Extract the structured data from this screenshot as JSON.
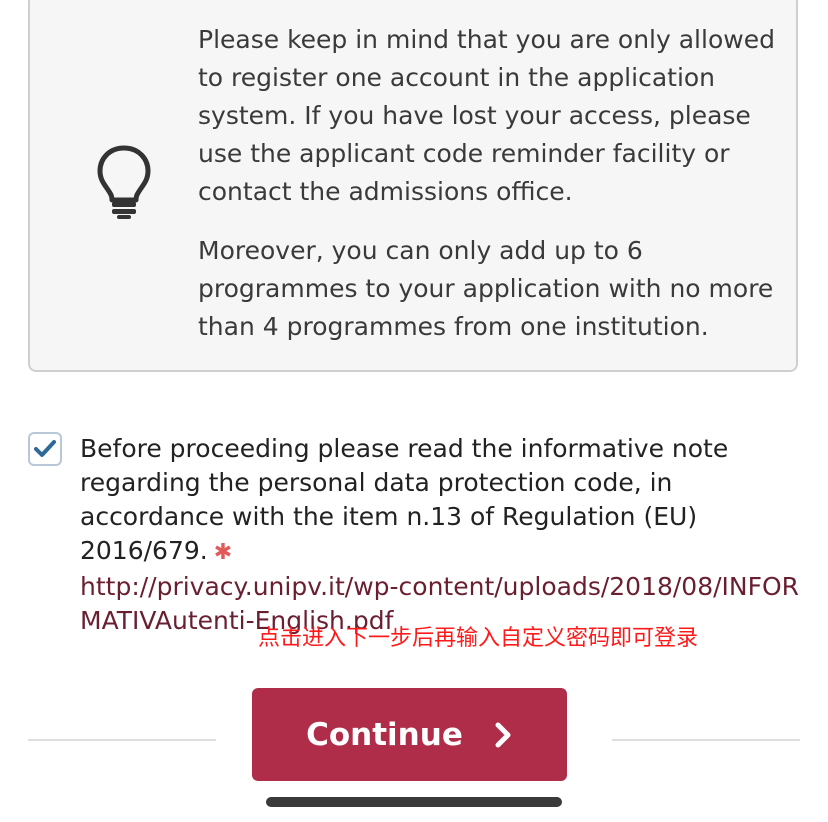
{
  "notice": {
    "icon": "lightbulb-icon",
    "paragraph_1": "Please keep in mind that you are only allowed to register one account in the application system. If you have lost your access, please use the applicant code reminder facility or contact the admissions office.",
    "paragraph_2": "Moreover, you can only add up to 6 programmes to your application with no more than 4 programmes from one institution."
  },
  "consent": {
    "checked": true,
    "text": "Before proceeding please read the informative note regarding the personal data protection code, in accordance with the item n.13 of Regulation (EU) 2016/679.",
    "required_marker": "✱",
    "link": "http://privacy.unipv.it/wp-content/uploads/2018/08/INFORMATIVAutenti-English.pdf"
  },
  "annotation": "点击进入下一步后再输入自定义密码即可登录",
  "actions": {
    "continue_label": "Continue",
    "continue_icon": "chevron-right-icon",
    "accent_color": "#b02d4a"
  }
}
